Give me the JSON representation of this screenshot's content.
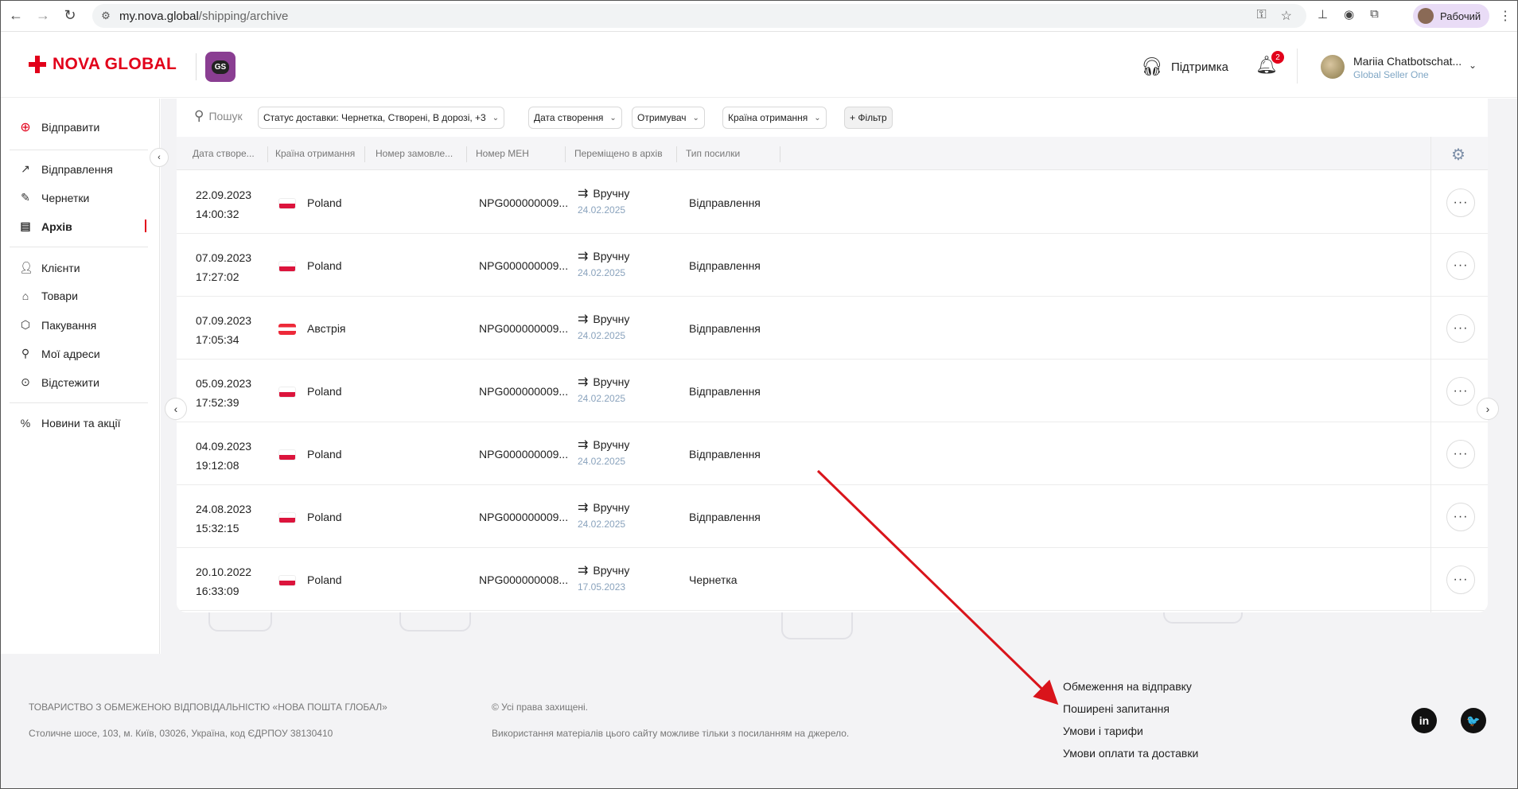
{
  "browser": {
    "url_host": "my.nova.global",
    "url_path": "/shipping/archive",
    "profile_label": "Рабочий"
  },
  "header": {
    "logo_text": "NOVA GLOBAL",
    "badge_text": "GS",
    "support_label": "Підтримка",
    "notifications_count": "2",
    "user_name": "Mariia Chatbotschat...",
    "user_role": "Global Seller One"
  },
  "sidebar": {
    "send_label": "Відправити",
    "items": [
      {
        "label": "Відправлення",
        "icon": "arrow-up-right-icon"
      },
      {
        "label": "Чернетки",
        "icon": "edit-icon"
      },
      {
        "label": "Архів",
        "icon": "archive-icon"
      },
      {
        "label": "Клієнти",
        "icon": "users-icon"
      },
      {
        "label": "Товари",
        "icon": "tag-icon"
      },
      {
        "label": "Пакування",
        "icon": "box-icon"
      },
      {
        "label": "Мої адреси",
        "icon": "address-icon"
      },
      {
        "label": "Відстежити",
        "icon": "target-icon"
      },
      {
        "label": "Новини та акції",
        "icon": "percent-icon"
      }
    ]
  },
  "filters": {
    "search_placeholder": "Пошук",
    "status": "Статус доставки: Чернетка, Створені, В дорозі, +3",
    "created": "Дата створення",
    "recipient": "Отримувач",
    "country": "Країна отримання",
    "add_filter": "+ Фільтр"
  },
  "table": {
    "columns": [
      "Дата створе...",
      "Країна отримання",
      "Номер замовле...",
      "Номер МЕН",
      "Переміщено в архів",
      "Тип посилки"
    ],
    "rows": [
      {
        "date": "22.09.2023",
        "time": "14:00:32",
        "flag": "pl",
        "country": "Poland",
        "meh": "NPG000000009...",
        "moved": "Вручну",
        "moved_date": "24.02.2025",
        "type": "Відправлення"
      },
      {
        "date": "07.09.2023",
        "time": "17:27:02",
        "flag": "pl",
        "country": "Poland",
        "meh": "NPG000000009...",
        "moved": "Вручну",
        "moved_date": "24.02.2025",
        "type": "Відправлення"
      },
      {
        "date": "07.09.2023",
        "time": "17:05:34",
        "flag": "at",
        "country": "Австрія",
        "meh": "NPG000000009...",
        "moved": "Вручну",
        "moved_date": "24.02.2025",
        "type": "Відправлення"
      },
      {
        "date": "05.09.2023",
        "time": "17:52:39",
        "flag": "pl",
        "country": "Poland",
        "meh": "NPG000000009...",
        "moved": "Вручну",
        "moved_date": "24.02.2025",
        "type": "Відправлення"
      },
      {
        "date": "04.09.2023",
        "time": "19:12:08",
        "flag": "pl",
        "country": "Poland",
        "meh": "NPG000000009...",
        "moved": "Вручну",
        "moved_date": "24.02.2025",
        "type": "Відправлення"
      },
      {
        "date": "24.08.2023",
        "time": "15:32:15",
        "flag": "pl",
        "country": "Poland",
        "meh": "NPG000000009...",
        "moved": "Вручну",
        "moved_date": "24.02.2025",
        "type": "Відправлення"
      },
      {
        "date": "20.10.2022",
        "time": "16:33:09",
        "flag": "pl",
        "country": "Poland",
        "meh": "NPG000000008...",
        "moved": "Вручну",
        "moved_date": "17.05.2023",
        "type": "Чернетка"
      }
    ]
  },
  "footer": {
    "company": "ТОВАРИСТВО З ОБМЕЖЕНОЮ ВІДПОВІДАЛЬНІСТЮ «НОВА ПОШТА ГЛОБАЛ»",
    "address": "Столичне шосе, 103, м. Київ, 03026, Україна, код ЄДРПОУ 38130410",
    "rights": "© Усі права захищені.",
    "usage": "Використання матеріалів цього сайту можливе тільки з посиланням на джерело.",
    "links": [
      "Обмеження на відправку",
      "Поширені запитання",
      "Умови і тарифи",
      "Умови оплати та доставки"
    ],
    "social": [
      {
        "label": "in",
        "icon": "linkedin-icon"
      },
      {
        "label": "🐦",
        "icon": "twitter-icon"
      }
    ]
  },
  "colors": {
    "brand_red": "#e2001a",
    "badge_purple": "#8a3e92",
    "moved_date_blue": "#8aa3bd",
    "annotation_arrow": "#d9141b"
  }
}
